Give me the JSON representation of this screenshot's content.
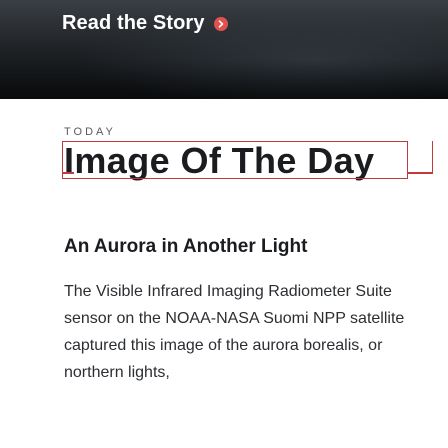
{
  "hero": {
    "link_label": "Read the Story",
    "link_icon": "chevron-right-circle-icon",
    "accent_color": "#e0524f"
  },
  "section": {
    "eyebrow": "TODAY",
    "title": "Image Of The Day"
  },
  "story": {
    "title": "An Aurora in Another Light",
    "body": "The Visible Infrared Imaging Radiometer Suite sensor on the NOAA-NASA Suomi NPP satellite captured this image of the aurora borealis, or northern lights,"
  }
}
